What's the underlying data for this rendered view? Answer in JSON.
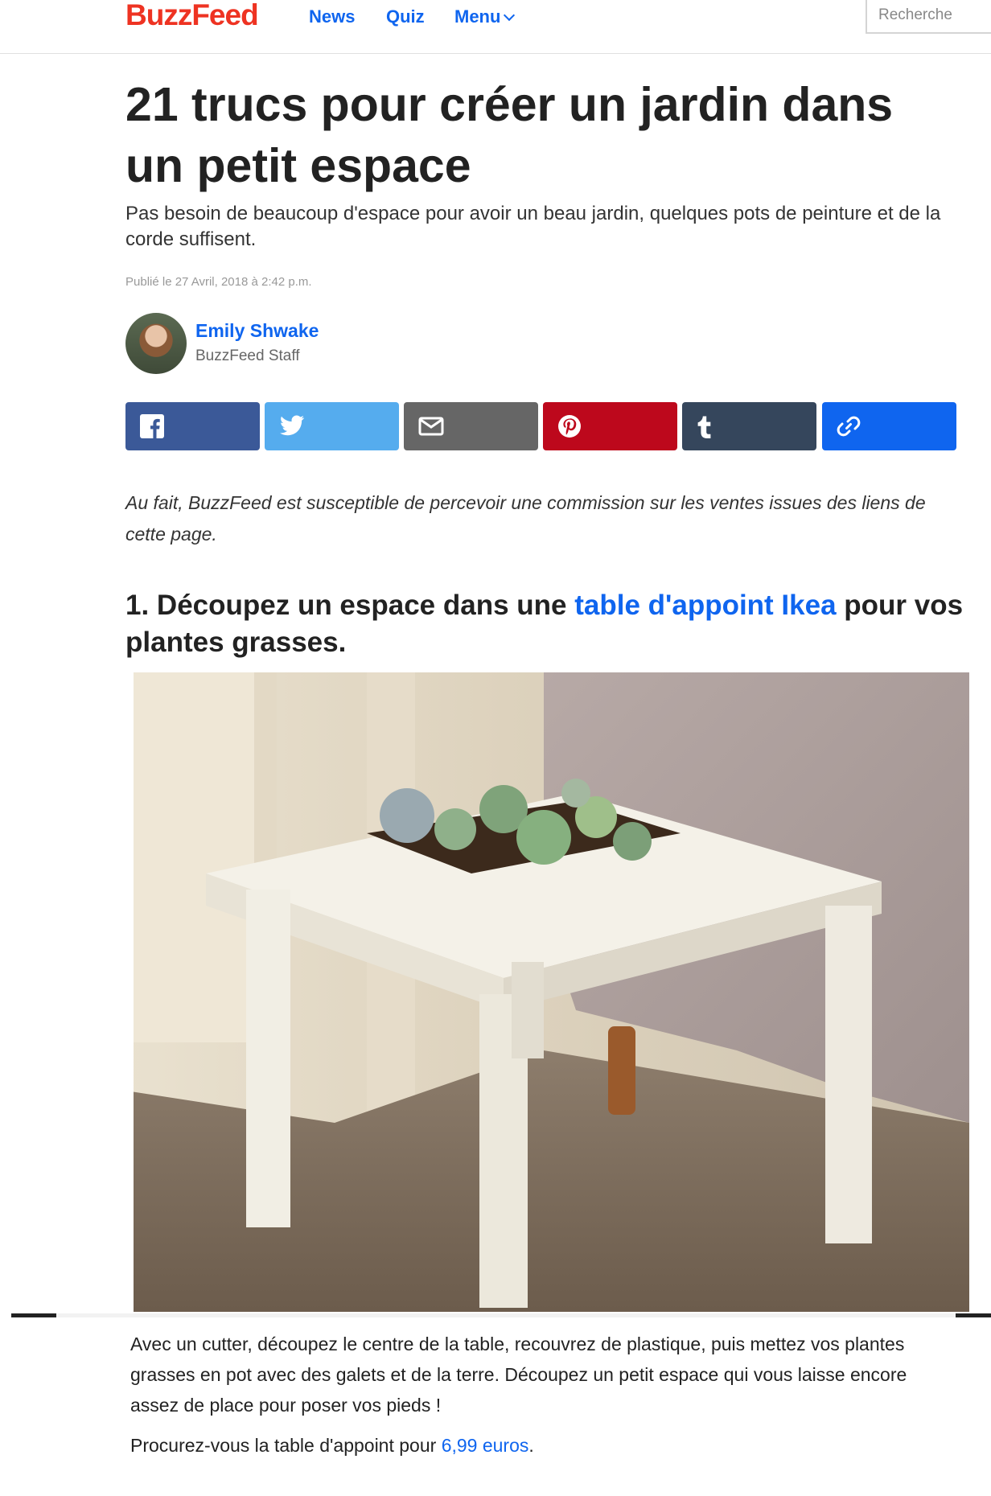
{
  "header": {
    "logo": "BuzzFeed",
    "nav": [
      {
        "label": "News"
      },
      {
        "label": "Quiz"
      },
      {
        "label": "Menu"
      }
    ],
    "search_placeholder": "Recherche"
  },
  "article": {
    "title": "21 trucs pour créer un jardin dans un petit espace",
    "dek": "Pas besoin de beaucoup d'espace pour avoir un beau jardin, quelques pots de peinture et de la corde suffisent.",
    "timestamp": "Publié le 27 Avril, 2018 à 2:42 p.m.",
    "author": {
      "name": "Emily Shwake",
      "role": "BuzzFeed Staff"
    },
    "share_buttons": [
      {
        "name": "facebook",
        "color": "#3b5998",
        "icon": "facebook-icon"
      },
      {
        "name": "twitter",
        "color": "#55acee",
        "icon": "twitter-icon"
      },
      {
        "name": "email",
        "color": "#666666",
        "icon": "email-icon"
      },
      {
        "name": "pinterest",
        "color": "#bd081c",
        "icon": "pinterest-icon"
      },
      {
        "name": "tumblr",
        "color": "#35465c",
        "icon": "tumblr-icon"
      },
      {
        "name": "copy-link",
        "color": "#0f65ef",
        "icon": "link-icon"
      }
    ],
    "disclaimer": "Au fait, BuzzFeed est susceptible de percevoir une commission sur les ventes issues des liens de cette page.",
    "item": {
      "heading_prefix": "1. Découpez un espace dans une ",
      "heading_link": "table d'appoint Ikea",
      "heading_suffix": " pour vos plantes grasses.",
      "caption": "Avec un cutter, découpez le centre de la table, recouvrez de plastique, puis mettez vos plantes grasses en pot avec des galets et de la terre. Découpez un petit espace qui vous laisse encore assez de place pour poser vos pieds !",
      "price_prefix": "Procurez-vous la table d'appoint pour ",
      "price_link": "6,99 euros",
      "price_suffix": "."
    }
  },
  "colors": {
    "brand": "#ee3322",
    "link": "#0f65ef"
  }
}
